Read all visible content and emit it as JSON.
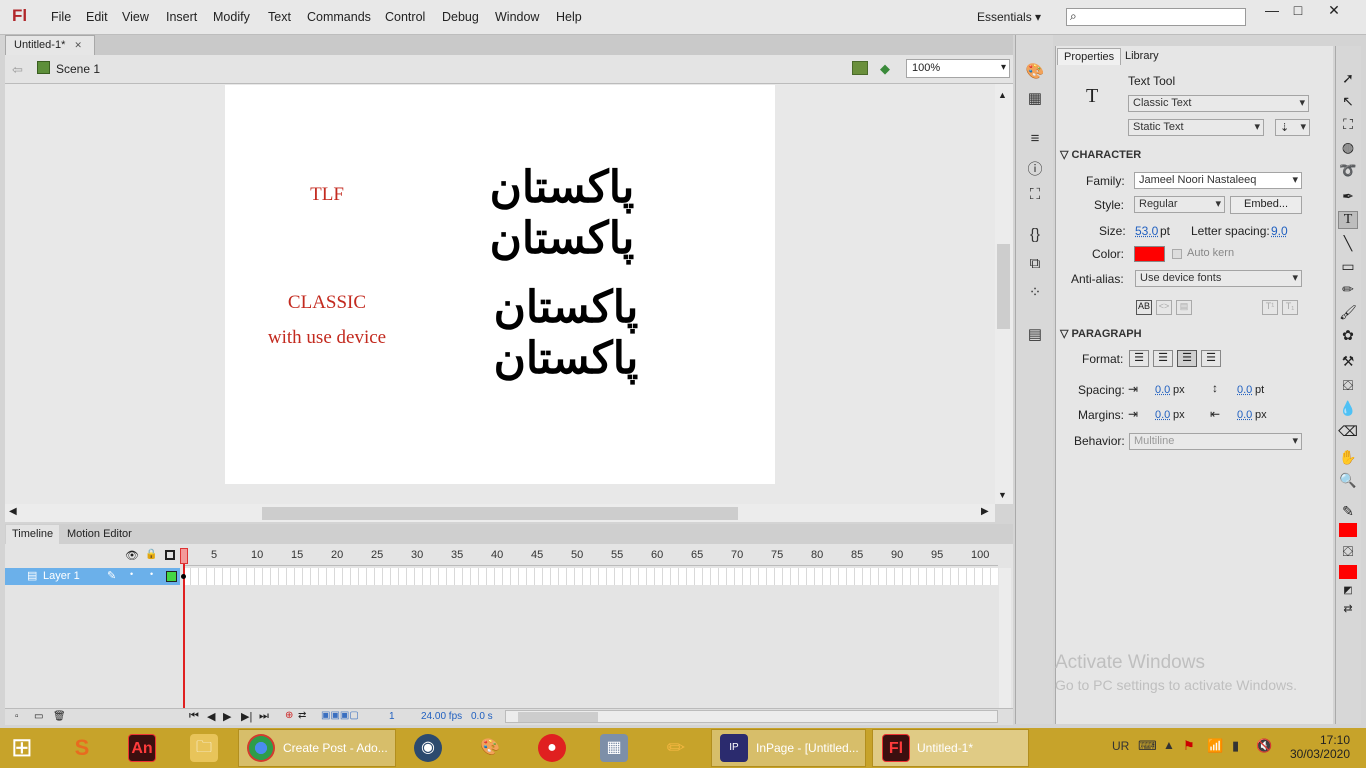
{
  "app": {
    "logo": "Fl"
  },
  "menu": [
    "File",
    "Edit",
    "View",
    "Insert",
    "Modify",
    "Text",
    "Commands",
    "Control",
    "Debug",
    "Window",
    "Help"
  ],
  "workspace": {
    "label": "Essentials ▾"
  },
  "window_controls": {
    "min": "—",
    "max": "□",
    "close": "✕"
  },
  "document": {
    "tab": "Untitled-1*",
    "tab_close": "✕",
    "scene": "Scene 1",
    "zoom": "100%"
  },
  "stage": {
    "labels": [
      "TLF",
      "CLASSIC",
      "with use device"
    ],
    "urdu_text_1": "پاکستان پاکستان",
    "urdu_text_2": "پاکستان پاکستان"
  },
  "timeline": {
    "tabs": [
      "Timeline",
      "Motion Editor"
    ],
    "layer": "Layer 1",
    "ticks": [
      "1",
      "5",
      "10",
      "15",
      "20",
      "25",
      "30",
      "35",
      "40",
      "45",
      "50",
      "55",
      "60",
      "65",
      "70",
      "75",
      "80",
      "85",
      "90",
      "95",
      "100"
    ],
    "frame": "1",
    "fps": "24.00 fps",
    "time": "0.0 s"
  },
  "properties": {
    "tabs": [
      "Properties",
      "Library"
    ],
    "tool_name": "Text Tool",
    "tool_icon": "T",
    "text_engine": "Classic Text",
    "text_type": "Static Text",
    "character_header": "CHARACTER",
    "family_label": "Family:",
    "family": "Jameel Noori Nastaleeq",
    "style_label": "Style:",
    "style": "Regular",
    "embed": "Embed...",
    "size_label": "Size:",
    "size": "53.0",
    "size_unit": "pt",
    "letter_spacing_label": "Letter spacing:",
    "letter_spacing": "9.0",
    "color_label": "Color:",
    "color": "#ff0000",
    "auto_kern": "Auto kern",
    "antialias_label": "Anti-alias:",
    "antialias": "Use device fonts",
    "paragraph_header": "PARAGRAPH",
    "format_label": "Format:",
    "spacing_label": "Spacing:",
    "spacing_indent": "0.0",
    "spacing_line": "0.0",
    "margins_label": "Margins:",
    "margin_left": "0.0",
    "margin_right": "0.0",
    "unit_px": "px",
    "unit_pt": "pt",
    "behavior_label": "Behavior:",
    "behavior": "Multiline"
  },
  "watermark": {
    "line1": "Activate Windows",
    "line2": "Go to PC settings to activate Windows."
  },
  "taskbar": {
    "items": [
      "Create Post - Ado...",
      "InPage - [Untitled...",
      "Untitled-1*"
    ],
    "lang": "UR",
    "time": "17:10",
    "date": "30/03/2020"
  },
  "colors": {
    "accent": "#b1262a",
    "stage_label": "#c32a1f",
    "taskbar": "#c7a32a"
  }
}
